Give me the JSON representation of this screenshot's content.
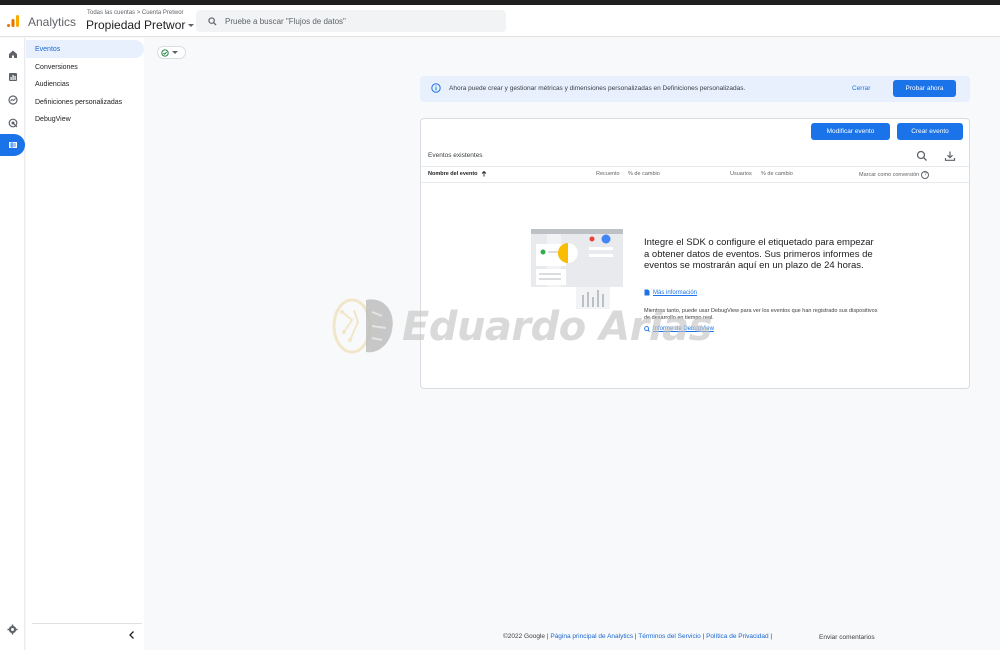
{
  "header": {
    "app_name": "Analytics",
    "breadcrumb": "Todas las cuentas > Cuenta Pretwor",
    "property": "Propiedad Pretwor",
    "search_placeholder": "Pruebe a buscar \"Flujos de datos\""
  },
  "rail": {
    "icons": [
      "home-icon",
      "reports-icon",
      "explore-icon",
      "advertising-icon",
      "configure-icon",
      "settings-icon"
    ]
  },
  "sidenav": {
    "items": [
      {
        "label": "Eventos",
        "active": true
      },
      {
        "label": "Conversiones",
        "active": false
      },
      {
        "label": "Audiencias",
        "active": false
      },
      {
        "label": "Definiciones personalizadas",
        "active": false
      },
      {
        "label": "DebugView",
        "active": false
      }
    ]
  },
  "banner": {
    "text": "Ahora puede crear y gestionar métricas y dimensiones personalizadas en Definiciones personalizadas.",
    "close_label": "Cerrar",
    "try_label": "Probar ahora"
  },
  "card": {
    "modify_label": "Modificar evento",
    "create_label": "Crear evento",
    "title": "Eventos existentes",
    "columns": {
      "event_name": "Nombre del evento",
      "count": "Recuento",
      "count_change": "% de cambio",
      "users": "Usuarios",
      "users_change": "% de cambio",
      "mark_conversion": "Marcar como conversión"
    },
    "empty": {
      "title": "Integre el SDK o configure el etiquetado para empezar a obtener datos de eventos. Sus primeros informes de eventos se mostrarán aquí en un plazo de 24 horas.",
      "more_info": "Más información",
      "desc": "Mientras tanto, puede usar DebugView para ver los eventos que han registrado sus dispositivos de desarrollo en tiempo real.",
      "debug_link": "Informe de DebugView"
    }
  },
  "watermark": "Eduardo Arias",
  "footer": {
    "copyright": "©2022 Google |",
    "home_link": "Página principal de Analytics",
    "terms_link": "Términos del Servicio",
    "privacy_link": "Política de Privacidad",
    "feedback": "Enviar comentarios"
  },
  "colors": {
    "accent": "#1a73e8",
    "banner_bg": "#e8f0fe",
    "logo_orange": "#f9ab00",
    "logo_dark": "#e37400"
  }
}
